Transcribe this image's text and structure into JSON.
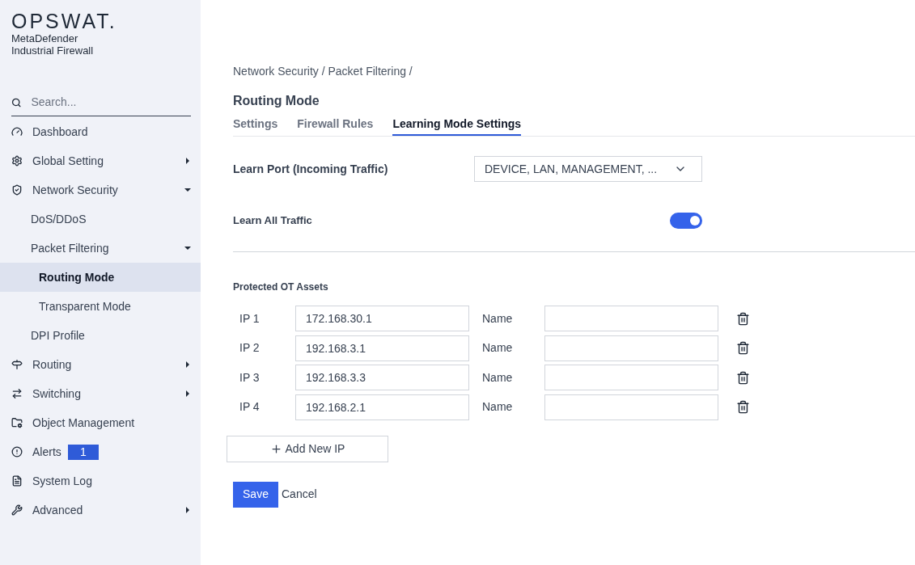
{
  "sidebar": {
    "logo": "OPSWAT.",
    "product": [
      "MetaDefender",
      "Industrial Firewall"
    ],
    "search": {
      "placeholder": "Search..."
    },
    "items": [
      {
        "label": "Dashboard",
        "selected": false
      },
      {
        "label": "Global Setting",
        "selected": false,
        "expanded": false
      },
      {
        "label": "Network Security",
        "selected": false,
        "expanded": true,
        "children": [
          {
            "label": "DoS/DDoS",
            "selected": false
          },
          {
            "label": "Packet Filtering",
            "selected": false,
            "expanded": true,
            "children": [
              {
                "label": "Routing Mode",
                "selected": true
              },
              {
                "label": "Transparent Mode",
                "selected": false
              }
            ]
          },
          {
            "label": "DPI Profile",
            "selected": false
          }
        ]
      },
      {
        "label": "Routing",
        "selected": false,
        "expanded": false
      },
      {
        "label": "Switching",
        "selected": false,
        "expanded": false
      },
      {
        "label": "Object Management",
        "selected": false
      },
      {
        "label": "Alerts",
        "selected": false,
        "badge": "1"
      },
      {
        "label": "System Log",
        "selected": false
      },
      {
        "label": "Advanced",
        "selected": false,
        "expanded": false
      }
    ]
  },
  "breadcrumb": "Network Security / Packet Filtering /",
  "title": "Routing Mode",
  "tabs": [
    {
      "label": "Settings",
      "selected": false
    },
    {
      "label": "Firewall Rules",
      "selected": false
    },
    {
      "label": "Learning Mode Settings",
      "selected": true
    }
  ],
  "learn_port": {
    "label": "Learn Port (Incoming Traffic)",
    "value": "DEVICE, LAN, MANAGEMENT, ..."
  },
  "learn_all": {
    "label": "Learn All Traffic",
    "on": true
  },
  "assets": {
    "title": "Protected OT Assets",
    "rows": [
      {
        "label": "IP 1",
        "ip": "172.168.30.1",
        "name_label": "Name"
      },
      {
        "label": "IP 2",
        "ip": "192.168.3.1",
        "name_label": "Name"
      },
      {
        "label": "IP 3",
        "ip": "192.168.3.3",
        "name_label": "Name"
      },
      {
        "label": "IP 4",
        "ip": "192.168.2.1",
        "name_label": "Name"
      }
    ],
    "add_button": "Add New IP"
  },
  "save": "Save",
  "cancel": "Cancel"
}
